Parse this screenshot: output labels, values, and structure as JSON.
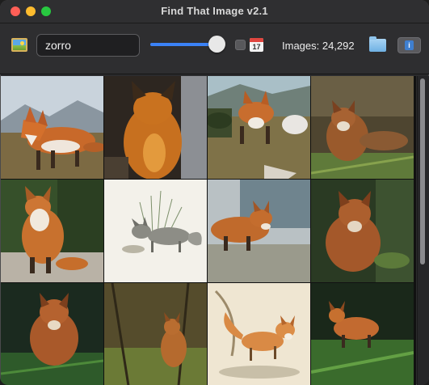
{
  "window": {
    "title": "Find That Image v2.1"
  },
  "toolbar": {
    "app_icon": "picture-icon",
    "search": {
      "value": "zorro",
      "placeholder": ""
    },
    "size_slider": {
      "level": 0.93
    },
    "date_filter": {
      "checked": false,
      "icon": "calendar-icon",
      "day": "17"
    },
    "images_label": "Images: 24,292",
    "folder_icon": "folder-icon",
    "info_icon": "info-icon"
  },
  "grid": {
    "images": [
      {
        "subject": "fox"
      },
      {
        "subject": "fox"
      },
      {
        "subject": "fox"
      },
      {
        "subject": "fox"
      },
      {
        "subject": "fox"
      },
      {
        "subject": "fox"
      },
      {
        "subject": "fox"
      },
      {
        "subject": "fox"
      },
      {
        "subject": "fox"
      },
      {
        "subject": "fox"
      },
      {
        "subject": "fox"
      },
      {
        "subject": "fox"
      }
    ]
  },
  "colors": {
    "accent": "#3b82f6",
    "close": "#ff5f57",
    "minimize": "#febc2e",
    "zoom": "#28c840"
  }
}
